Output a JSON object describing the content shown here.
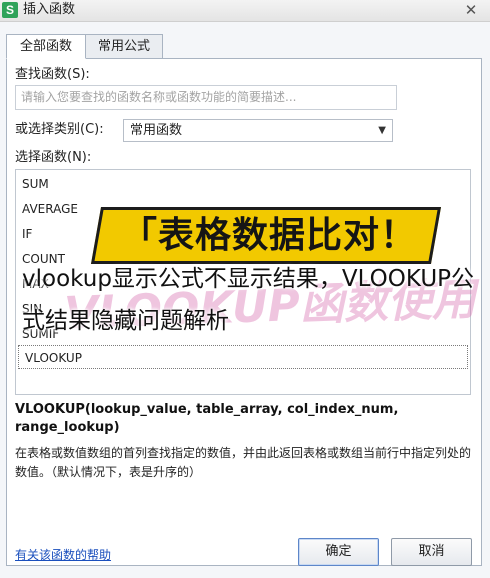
{
  "window": {
    "icon_letter": "S",
    "title": "插入函数",
    "close_glyph": "✕"
  },
  "tabs": [
    {
      "label": "全部函数",
      "active": true
    },
    {
      "label": "常用公式",
      "active": false
    }
  ],
  "search": {
    "label": "查找函数(S):",
    "placeholder": "请输入您要查找的函数名称或函数功能的简要描述..."
  },
  "category": {
    "label": "或选择类别(C):",
    "selected": "常用函数"
  },
  "function_list": {
    "label": "选择函数(N):",
    "items": [
      "SUM",
      "AVERAGE",
      "IF",
      "COUNT",
      "MAX",
      "SIN",
      "SUMIF",
      "VLOOKUP"
    ],
    "selected": "VLOOKUP"
  },
  "signature": "VLOOKUP(lookup_value, table_array, col_index_num, range_lookup)",
  "description": "在表格或数值数组的首列查找指定的数值，并由此返回表格或数组当前行中指定列处的数值。（默认情况下，表是升序的）",
  "footer": {
    "help_link": "有关该函数的帮助",
    "ok_label": "确定",
    "cancel_label": "取消"
  },
  "overlay": {
    "banner_text": "「表格数据比对！",
    "watermark_text": "VLOOKUP函数使用",
    "caption": "vlookup显示公式不显示结果，VLOOKUP公式结果隐藏问题解析"
  },
  "colors": {
    "banner_yellow": "#f2c900",
    "link_blue": "#1a4fbd",
    "watermark_pink": "#d666aa"
  }
}
